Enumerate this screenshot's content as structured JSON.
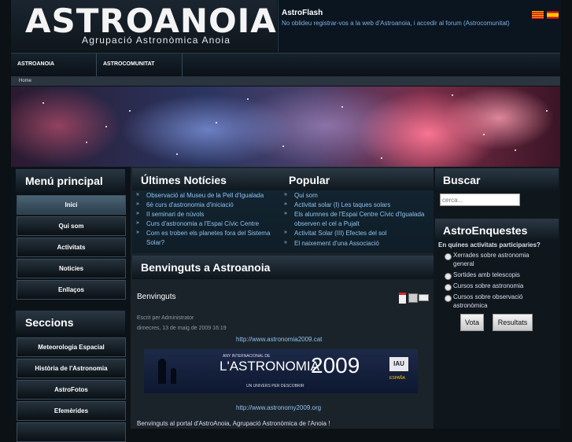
{
  "header": {
    "logo_text": "ASTROANOIA",
    "logo_subtitle": "Agrupació Astronòmica Anoia",
    "flash_title": "AstroFlash",
    "flash_message": "No oblideu registrar-vos a la web d'Astroanoia, i accedir al forum (Astrocomunitat)"
  },
  "nav": {
    "items": [
      "ASTROANOIA",
      "ASTROCOMUNITAT"
    ]
  },
  "breadcrumb": "Home",
  "left_menu": {
    "title": "Menú principal",
    "items": [
      "Inici",
      "Qui som",
      "Activitats",
      "Noticies",
      "Enllaços"
    ],
    "sections_title": "Seccions",
    "sections": [
      "Meteorologia Espacial",
      "Història de l'Astronomia",
      "AstroFotos",
      "Efemèrides"
    ]
  },
  "latest_news": {
    "title": "Últimes Notícies",
    "items": [
      "Observació al Museu de la Pell d'Igualada",
      "6è curs d'astronomia d'iniciació",
      "II seminari de núvols",
      "Curs d'astronomia a l'Espai Cívic Centre",
      "Com es troben els planetes fora del Sistema Solar?"
    ]
  },
  "popular": {
    "title": "Popular",
    "items": [
      "Qui som",
      "Activitat solar (I) Les taques solars",
      "Els alumnes de l'Espai Centre Cívic d'Igualada observen el cel a Pujalt",
      "Activitat Solar (III) Efectes del sol",
      "El naixement d'una Associació"
    ]
  },
  "article": {
    "heading": "Benvinguts a Astroanoia",
    "title": "Benvinguts",
    "author": "Escrit per Administrator",
    "date": "dimecres, 13 de maig de 2009 16:19",
    "link1": "http://www.astronomia2009.cat",
    "banner_title": "L'ASTRONOMIA",
    "banner_year": "2009",
    "banner_top": "ANY INTERNACIONAL DE",
    "banner_sub": "UN UNIVERS PER DESCOBRIR",
    "banner_badge": "IAU",
    "banner_country": "ESPAÑA",
    "link2": "http://www.astronomy2009.org",
    "intro": "Benvinguts al portal d'AstroAnoia, Agrupació Astronòmica de l'Anoia !"
  },
  "search": {
    "title": "Buscar",
    "placeholder": "cerca..."
  },
  "poll": {
    "title": "AstroEnquestes",
    "question": "En quines activitats participaries?",
    "options": [
      "Xerrades sobre astronomia general",
      "Sortides amb telescopis",
      "Cursos sobre astronomia",
      "Cursos sobre observació astronòmica"
    ],
    "vote_label": "Vota",
    "results_label": "Resultats"
  },
  "colors": {
    "link": "#8ec2f0",
    "background": "#0c1116",
    "flash_text": "#7fb0e0"
  }
}
